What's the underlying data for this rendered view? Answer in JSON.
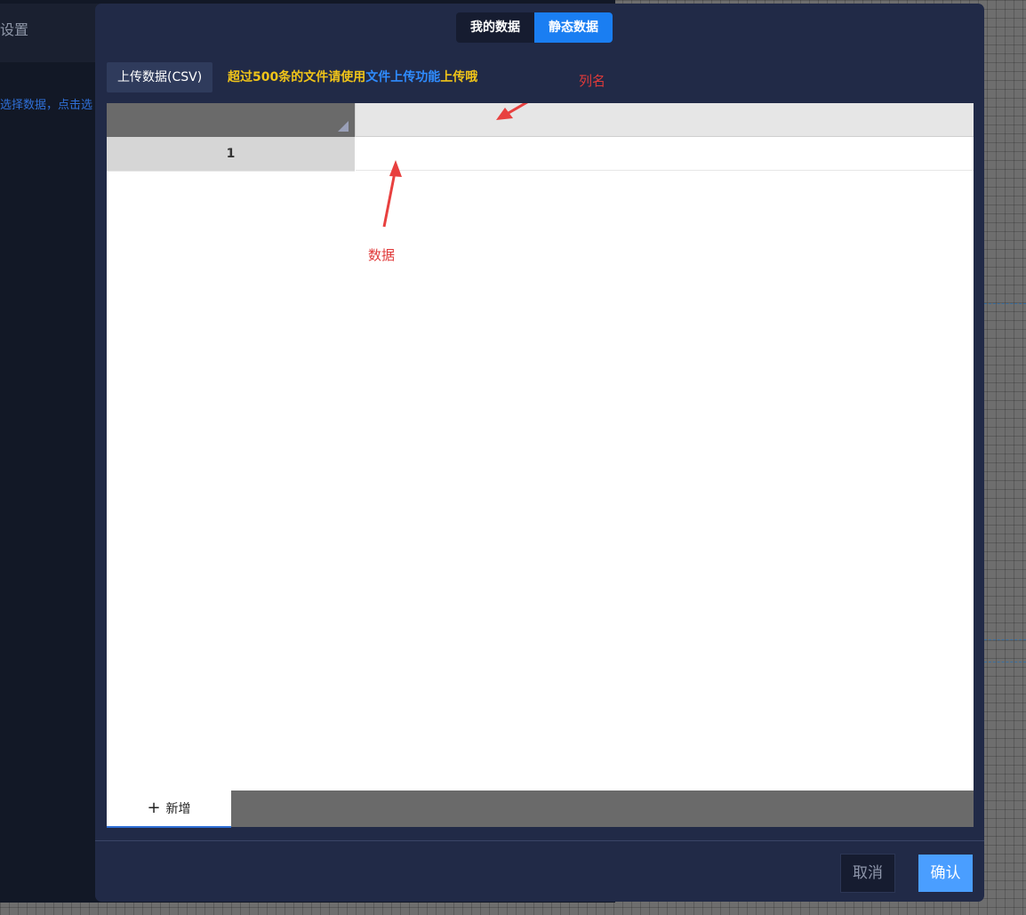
{
  "background": {
    "panel_title": "设置",
    "panel_hint": "选择数据，点击选"
  },
  "modal": {
    "tabs": [
      {
        "label": "我的数据",
        "active": false
      },
      {
        "label": "静态数据",
        "active": true
      }
    ],
    "upload_button": "上传数据(CSV)",
    "upload_tip": {
      "prefix": "超过500条的文件请使用",
      "link": "文件上传功能",
      "suffix": "上传哦"
    },
    "grid": {
      "row_numbers": [
        "1"
      ],
      "annotations": {
        "column_name": "列名",
        "data": "数据"
      },
      "add_button": "新增",
      "add_icon": "+"
    },
    "footer": {
      "cancel": "取消",
      "confirm": "确认"
    }
  },
  "colors": {
    "accent": "#1a7ef2",
    "confirm": "#4a9eff",
    "warning_text": "#f0c419",
    "annotation": "#e03a3a",
    "modal_bg": "#212a47"
  }
}
